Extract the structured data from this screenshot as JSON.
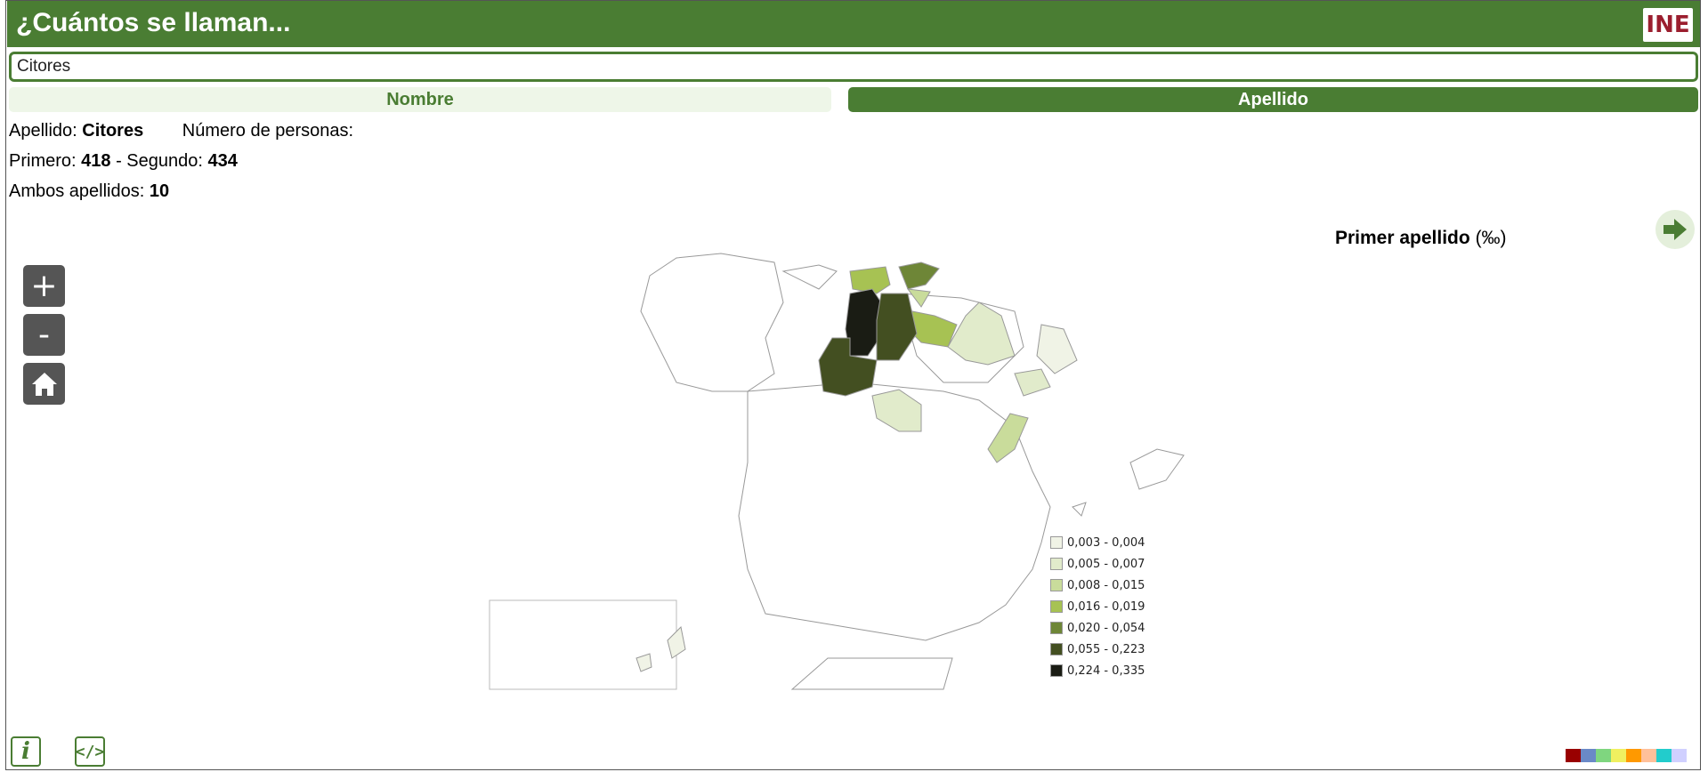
{
  "header": {
    "title": "¿Cuántos se llaman...",
    "logo_text": "INE"
  },
  "search": {
    "value": "Citores"
  },
  "tabs": [
    {
      "label": "Nombre",
      "active": false
    },
    {
      "label": "Apellido",
      "active": true
    }
  ],
  "info": {
    "apellido_label": "Apellido:",
    "apellido_value": "Citores",
    "personas_label": "Número de personas:",
    "primero_label": "Primero:",
    "primero_value": "418",
    "segundo_label": "- Segundo:",
    "segundo_value": "434",
    "ambos_label": "Ambos apellidos:",
    "ambos_value": "10"
  },
  "map": {
    "title": "Primer apellido",
    "unit": "(‰)",
    "legend": [
      {
        "label": "0,003 - 0,004",
        "color": "#f0f3e6"
      },
      {
        "label": "0,005 - 0,007",
        "color": "#e1ebcb"
      },
      {
        "label": "0,008 - 0,015",
        "color": "#c9dc9b"
      },
      {
        "label": "0,016 - 0,019",
        "color": "#a7c253"
      },
      {
        "label": "0,020 - 0,054",
        "color": "#6e8637"
      },
      {
        "label": "0,055 - 0,223",
        "color": "#434f21"
      },
      {
        "label": "0,224 - 0,335",
        "color": "#1a1c14"
      }
    ]
  },
  "controls": {
    "zoom_in": "+",
    "zoom_out": "-"
  },
  "palette": [
    "#990000",
    "#6a89c7",
    "#7fd67f",
    "#f0f060",
    "#ff9900",
    "#ffc09a",
    "#22cccc",
    "#d0d0ff"
  ]
}
